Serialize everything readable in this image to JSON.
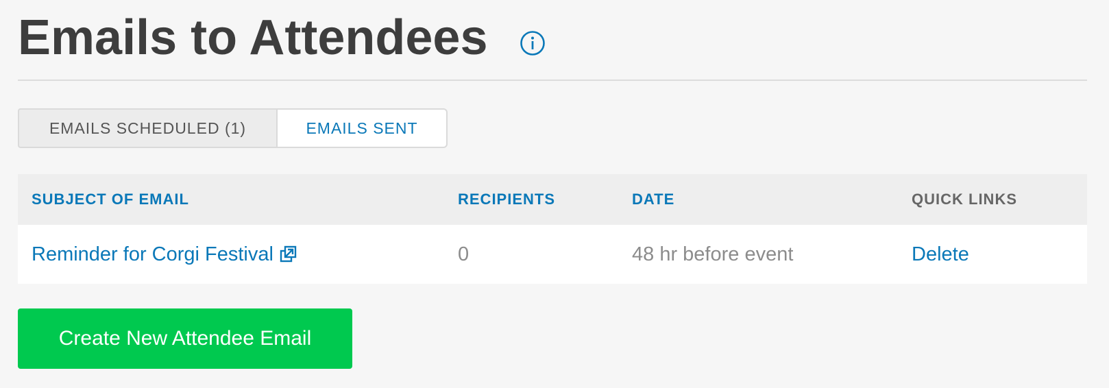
{
  "page": {
    "title": "Emails to Attendees",
    "info_icon": "info-circle-icon"
  },
  "tabs": [
    {
      "label": "EMAILS SCHEDULED (1)",
      "active": false
    },
    {
      "label": "EMAILS SENT",
      "active": true
    }
  ],
  "table": {
    "headers": {
      "subject": "SUBJECT OF EMAIL",
      "recipients": "RECIPIENTS",
      "date": "DATE",
      "quick_links": "QUICK LINKS"
    },
    "rows": [
      {
        "subject": "Reminder for Corgi Festival",
        "subject_icon": "external-link-icon",
        "recipients": "0",
        "date": "48 hr before event",
        "action": "Delete"
      }
    ]
  },
  "actions": {
    "create_label": "Create New Attendee Email"
  },
  "colors": {
    "link_blue": "#0a78b8",
    "button_green": "#00c94f",
    "title_text": "#3d3d3d"
  }
}
